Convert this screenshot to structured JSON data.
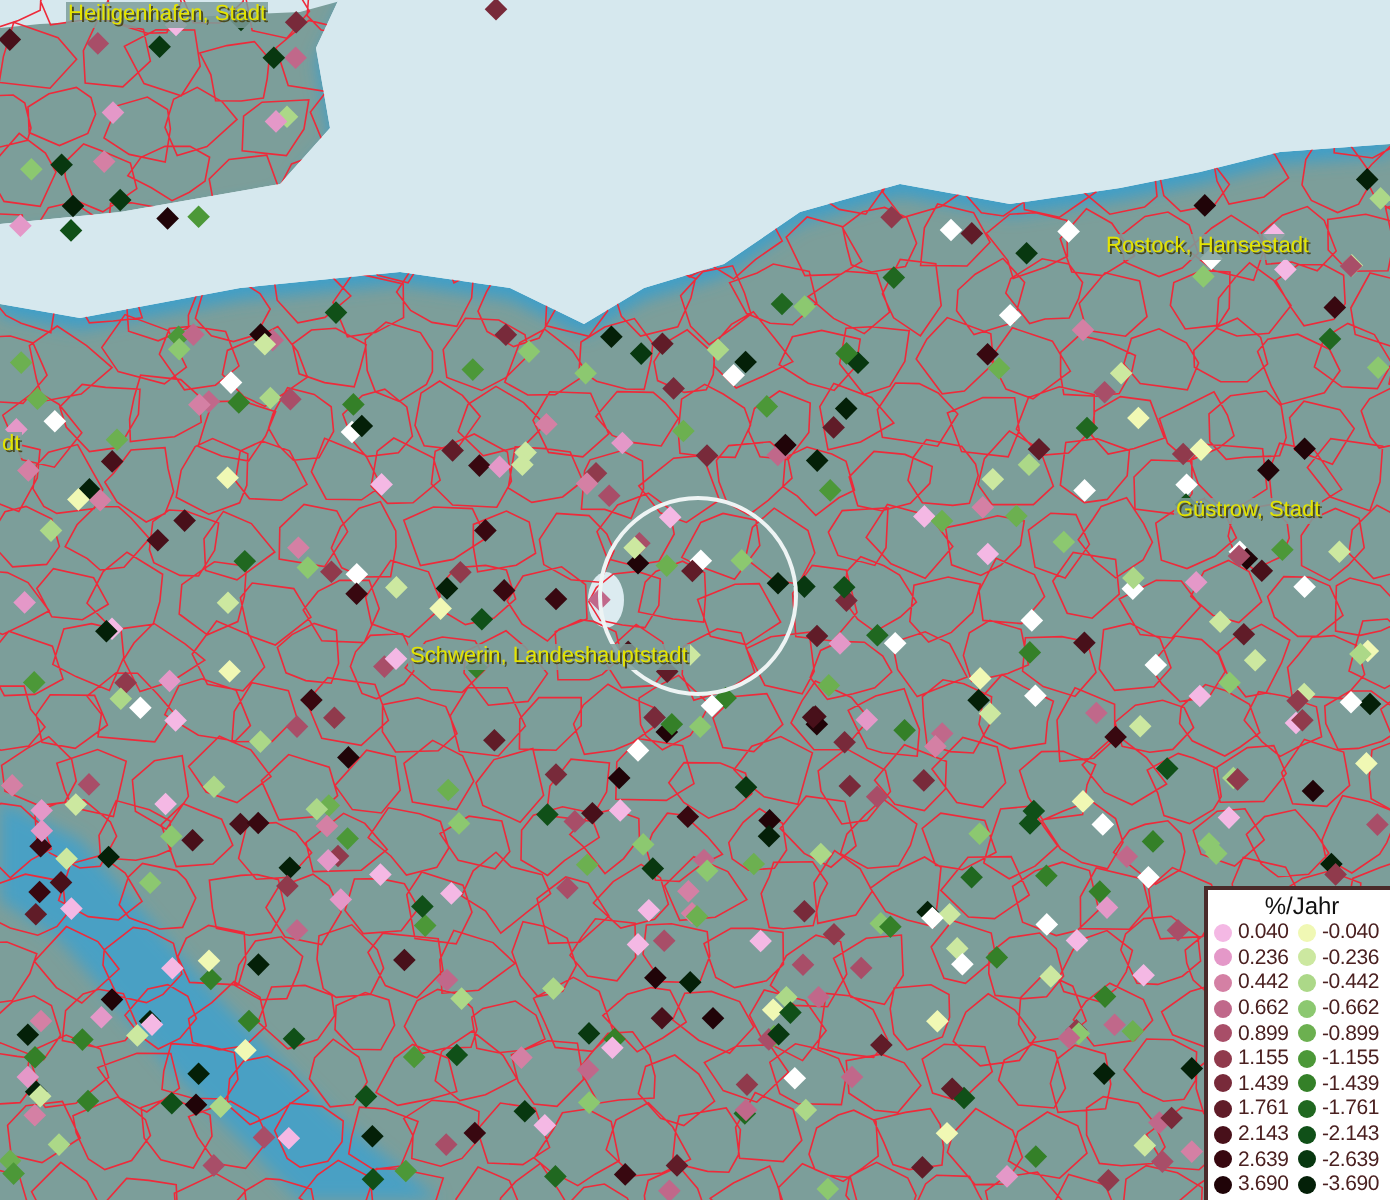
{
  "map": {
    "place_labels": [
      {
        "text": "Heiligenhafen, Stadt"
      },
      {
        "text": "dt"
      },
      {
        "text": "Rostock, Hansestadt"
      },
      {
        "text": "Güstrow, Stadt"
      },
      {
        "text": "Schwerin, Landeshauptstadt"
      }
    ]
  },
  "legend": {
    "title": "%/Jahr",
    "items": [
      {
        "label": "0.040",
        "color": "#f4b8e4"
      },
      {
        "label": "-0.040",
        "color": "#f0f8b4"
      },
      {
        "label": "0.236",
        "color": "#e498c8"
      },
      {
        "label": "-0.236",
        "color": "#cce8a0"
      },
      {
        "label": "0.442",
        "color": "#d480a4"
      },
      {
        "label": "-0.442",
        "color": "#acd888"
      },
      {
        "label": "0.662",
        "color": "#c0688a"
      },
      {
        "label": "-0.662",
        "color": "#8cc870"
      },
      {
        "label": "0.899",
        "color": "#a84e68"
      },
      {
        "label": "-0.899",
        "color": "#6cb050"
      },
      {
        "label": "1.155",
        "color": "#903a4c"
      },
      {
        "label": "-1.155",
        "color": "#4c9838"
      },
      {
        "label": "1.439",
        "color": "#782a3a"
      },
      {
        "label": "-1.439",
        "color": "#348028"
      },
      {
        "label": "1.761",
        "color": "#601c28"
      },
      {
        "label": "-1.761",
        "color": "#206820"
      },
      {
        "label": "2.143",
        "color": "#48101a"
      },
      {
        "label": "-2.143",
        "color": "#105018"
      },
      {
        "label": "2.639",
        "color": "#380810"
      },
      {
        "label": "-2.639",
        "color": "#083810"
      },
      {
        "label": "3.690",
        "color": "#200408"
      },
      {
        "label": "-3.690",
        "color": "#042008"
      }
    ]
  }
}
